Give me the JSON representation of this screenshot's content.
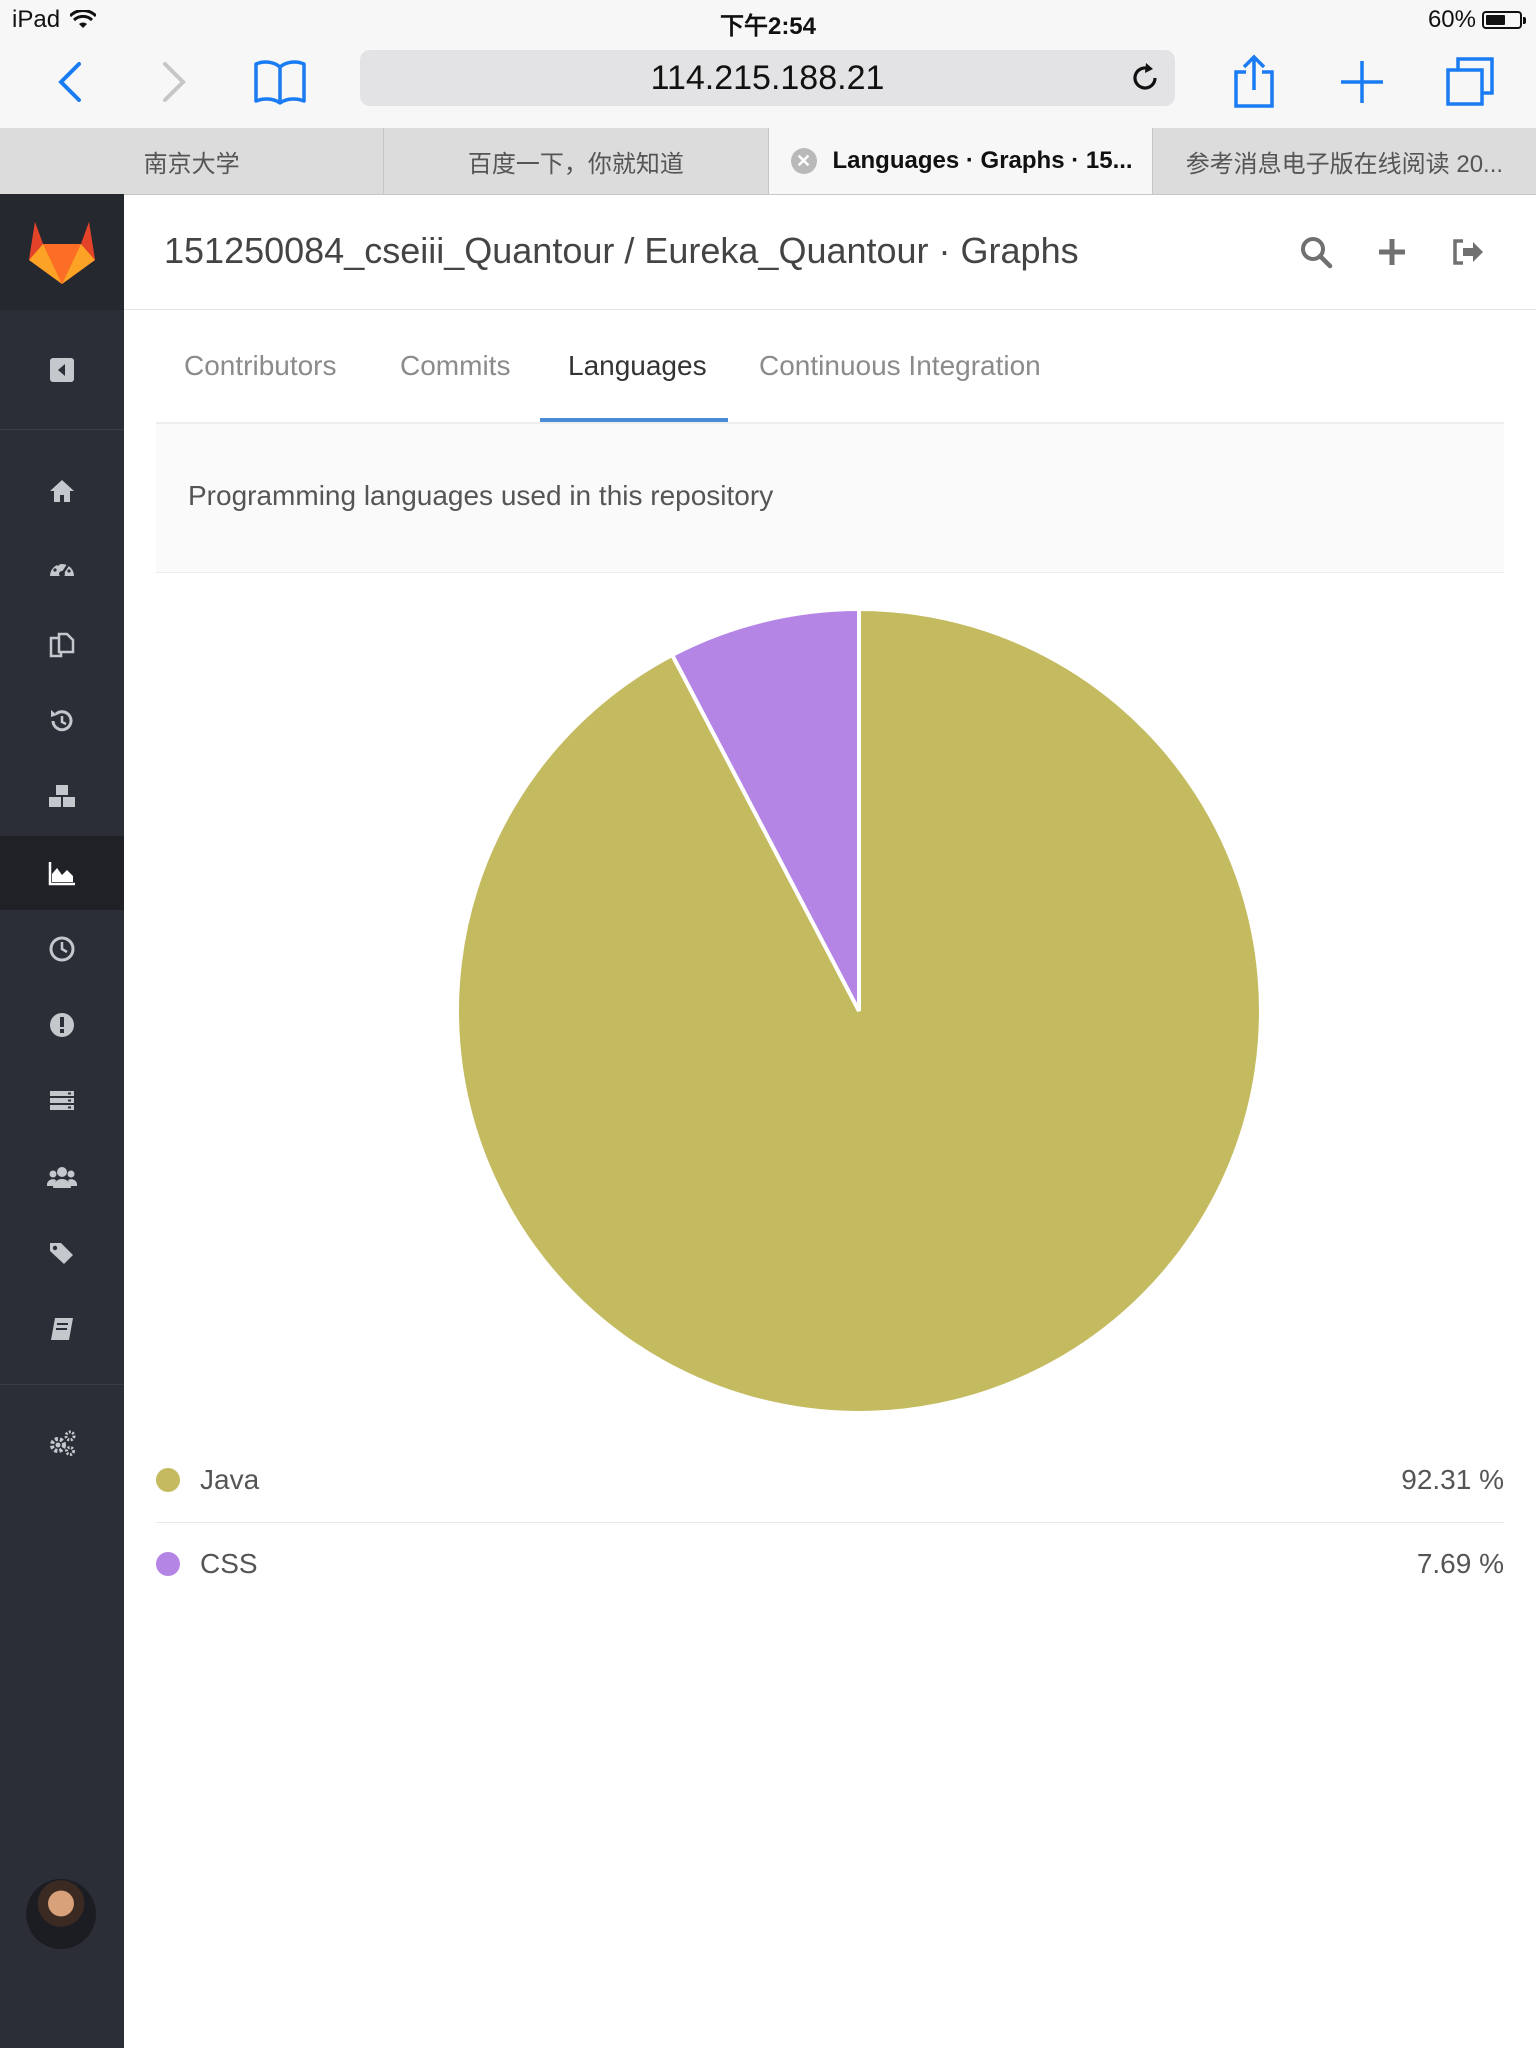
{
  "status_bar": {
    "device": "iPad",
    "time": "下午2:54",
    "battery_text": "60%",
    "battery_level": 0.6
  },
  "browser": {
    "url": "114.215.188.21",
    "tabs": [
      {
        "label": "南京大学"
      },
      {
        "label": "百度一下，你就知道"
      },
      {
        "label": "Languages · Graphs · 15..."
      },
      {
        "label": "参考消息电子版在线阅读 20..."
      }
    ],
    "active_tab_index": 2
  },
  "page": {
    "title": "151250084_cseiii_Quantour / Eureka_Quantour · Graphs",
    "tabs": [
      {
        "label": "Contributors"
      },
      {
        "label": "Commits"
      },
      {
        "label": "Languages"
      },
      {
        "label": "Continuous Integration"
      }
    ],
    "description": "Programming languages used in this repository"
  },
  "sidebar": {
    "icons": [
      "toggle-sidebar-icon",
      "home-icon",
      "dashboard-icon",
      "files-icon",
      "history-icon",
      "cubes-icon",
      "graph-icon",
      "clock-icon",
      "issues-icon",
      "server-icon",
      "users-icon",
      "tags-icon",
      "wiki-icon",
      "settings-icon"
    ],
    "active": "graph-icon"
  },
  "chart_data": {
    "type": "pie",
    "slices": [
      {
        "name": "Java",
        "value": 92.31,
        "label": "92.31 %",
        "color": "#c4bb61"
      },
      {
        "name": "CSS",
        "value": 7.69,
        "label": "7.69 %",
        "color": "#b585e6"
      }
    ]
  }
}
